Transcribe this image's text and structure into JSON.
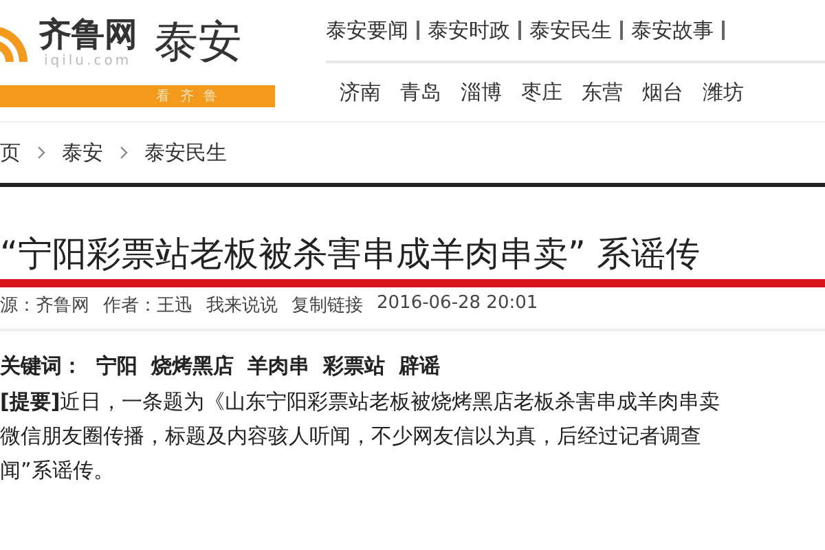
{
  "logo": {
    "name": "齐鲁网",
    "domain": "iqilu.com",
    "slogan": "看 齐 鲁",
    "city": "泰安"
  },
  "nav_primary": [
    "泰安要闻",
    "泰安时政",
    "泰安民生",
    "泰安故事"
  ],
  "nav_cities": [
    "济南",
    "青岛",
    "淄博",
    "枣庄",
    "东营",
    "烟台",
    "潍坊"
  ],
  "breadcrumb": [
    "页",
    "泰安",
    "泰安民生"
  ],
  "article": {
    "title": "“宁阳彩票站老板被杀害串成羊肉串卖”  系谣传",
    "meta": [
      "源：齐鲁网",
      "作者：王迅",
      "我来说说",
      "复制链接",
      "2016-06-28 20:01"
    ],
    "keywords_label": "关键词：",
    "keywords": [
      "宁阳",
      "烧烤黑店",
      "羊肉串",
      "彩票站",
      "辟谣"
    ],
    "summary": [
      "**[提要]**近日，一条题为《山东宁阳彩票站老板被烧烤黑店老板杀害串成羊肉串卖",
      "微信朋友圈传播，标题及内容骇人听闻，不少网友信以为真，后经过记者调查",
      "闻”系谣传。"
    ]
  }
}
